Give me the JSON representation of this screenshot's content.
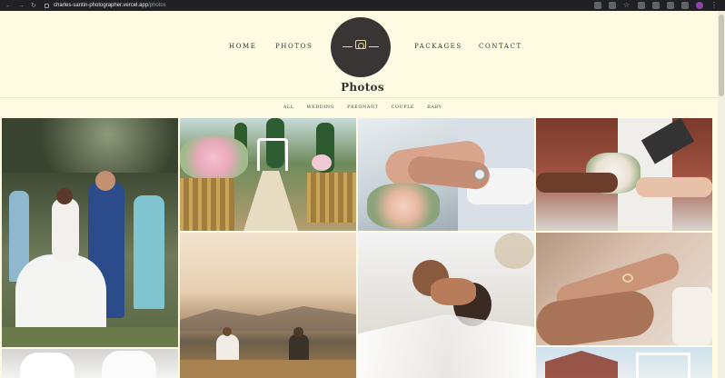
{
  "browser": {
    "url_host": "charles-santin-photographer.vercel.app",
    "url_path": "/photos"
  },
  "nav": {
    "home": "HOME",
    "photos": "PHOTOS",
    "packages": "PACKAGES",
    "contact": "CONTACT"
  },
  "page": {
    "title": "Photos"
  },
  "filters": [
    "ALL",
    "WEDDING",
    "PREGNANT",
    "COUPLE",
    "BABY"
  ],
  "colors": {
    "background": "#fffbe3",
    "logo_circle": "#3a3535",
    "logo_accent": "#e8d6a8",
    "text": "#333333"
  },
  "gallery": {
    "photos": [
      {
        "name": "couple-kissing-guests-petals",
        "icon": "photo-icon"
      },
      {
        "name": "wedding-aisle-flowers",
        "icon": "photo-icon"
      },
      {
        "name": "hands-with-rings-bouquet",
        "icon": "photo-icon"
      },
      {
        "name": "hands-bouquet-bride",
        "icon": "photo-icon"
      },
      {
        "name": "couple-walking-sunset-field",
        "icon": "photo-icon"
      },
      {
        "name": "couple-veil-kiss",
        "icon": "photo-icon"
      },
      {
        "name": "ring-on-finger",
        "icon": "photo-icon"
      },
      {
        "name": "bride-dress-detail",
        "icon": "photo-icon"
      },
      {
        "name": "outdoor-venue-arch",
        "icon": "photo-icon"
      }
    ]
  }
}
